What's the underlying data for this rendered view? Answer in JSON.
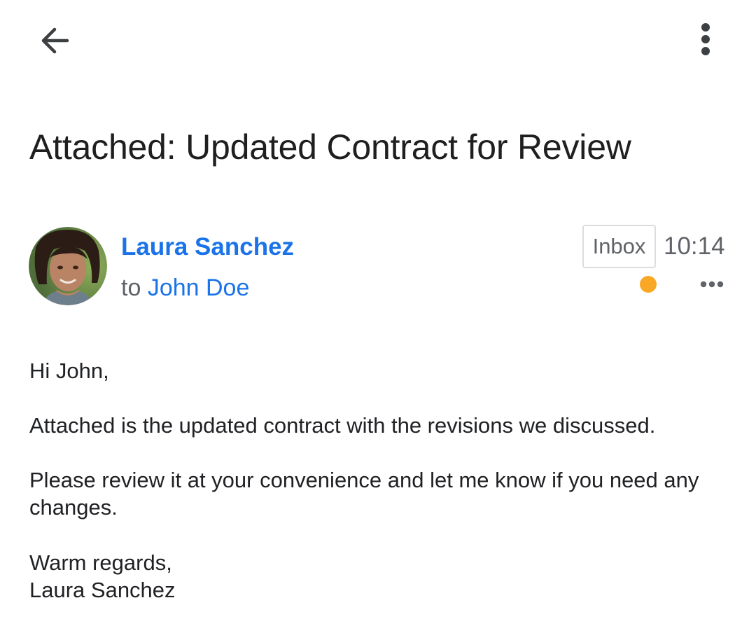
{
  "header": {
    "back_icon": "arrow-left-icon",
    "more_icon": "more-vert-icon"
  },
  "email": {
    "subject": "Attached: Updated Contract for Review",
    "sender": {
      "name": "Laura Sanchez",
      "avatar": "profile-photo"
    },
    "recipient_prefix": "to",
    "recipient": "John Doe",
    "label": "Inbox",
    "time": "10:14",
    "importance_color": "#f9a825",
    "details_icon": "more-horiz-icon",
    "body": {
      "greeting": "Hi John,",
      "paragraph1": "Attached is the updated contract with the revisions we discussed.",
      "paragraph2": "Please review it at your convenience and let me know if you need any changes.",
      "signoff": "Warm regards,",
      "signature": "Laura Sanchez"
    }
  },
  "colors": {
    "link": "#1a73e8",
    "secondary_text": "#5f6368",
    "primary_text": "#202124"
  }
}
